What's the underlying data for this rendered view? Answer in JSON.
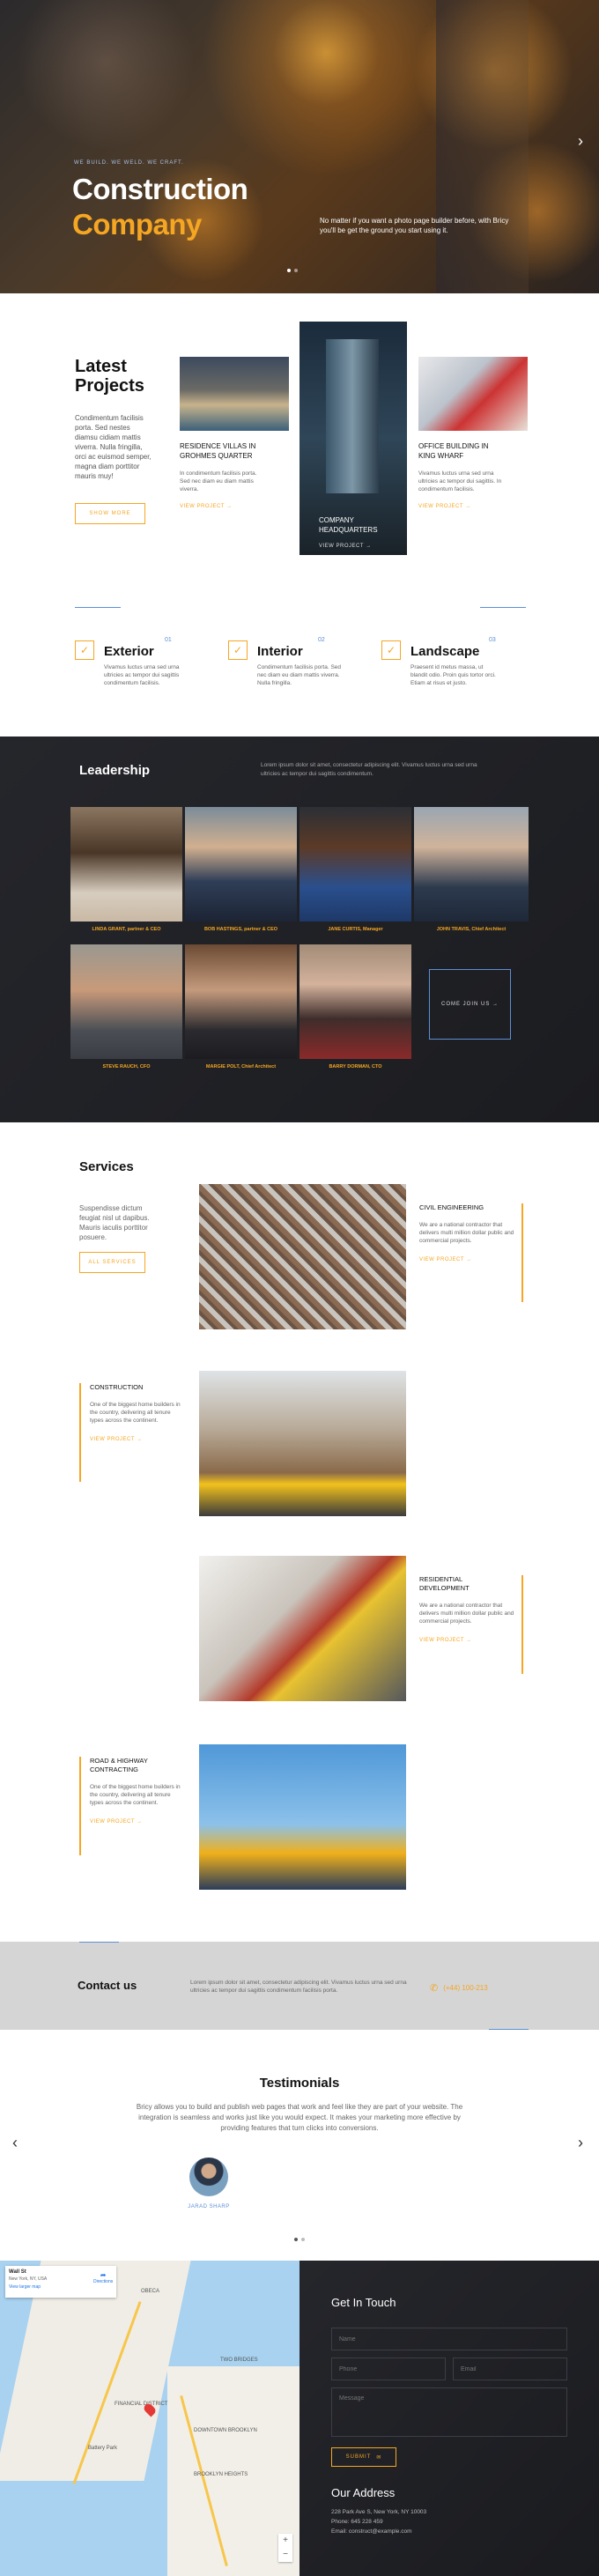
{
  "hero": {
    "eyebrow": "WE BUILD. WE WELD. WE CRAFT.",
    "title_line1": "Construction",
    "title_line2": "Company",
    "tagline": "No matter if you want a photo page builder before, with Bricy you'll be get the ground you start using it.",
    "arrow_left": "‹",
    "arrow_right": "›"
  },
  "projects": {
    "heading_line1": "Latest",
    "heading_line2": "Projects",
    "intro": "Condimentum facilisis porta. Sed nestes diamsu cidiam mattis viverra. Nulla fringilla, orci ac euismod semper, magna diam porttitor mauris muy!",
    "show_more": "SHOW MORE",
    "items": [
      {
        "title": "RESIDENCE VILLAS IN GROHMES QUARTER",
        "text": "In condimentum facilisis porta. Sed nec diam eu diam mattis viverra.",
        "link": "VIEW PROJECT"
      },
      {
        "title": "COMPANY HEADQUARTERS",
        "text": "",
        "link": "VIEW PROJECT"
      },
      {
        "title": "OFFICE BUILDING IN KING WHARF",
        "text": "Vivamus luctus urna sed urna ultricies ac tempor dui sagittis. In condimentum facilisis.",
        "link": "VIEW PROJECT"
      }
    ]
  },
  "features": [
    {
      "num": "01",
      "title": "Exterior",
      "text": "Vivamus luctus urna sed urna ultricies ac tempor dui sagittis condimentum facilisis."
    },
    {
      "num": "02",
      "title": "Interior",
      "text": "Condimentum facilisis porta. Sed nec diam eu diam mattis viverra. Nulla fringilla."
    },
    {
      "num": "03",
      "title": "Landscape",
      "text": "Praesent id metus massa, ut blandit odio. Proin quis tortor orci. Etiam at risus et justo."
    }
  ],
  "leadership": {
    "heading": "Leadership",
    "intro": "Lorem ipsum dolor sit amet, consectetur adipiscing elit. Vivamus luctus urna sed urna ultricies ac tempor dui sagittis condimentum.",
    "people": [
      {
        "name": "LINDA GRANT, partner & CEO"
      },
      {
        "name": "BOB HASTINGS, partner & CEO"
      },
      {
        "name": "JANE CURTIS, Manager"
      },
      {
        "name": "JOHN TRAVIS, Chief Architect"
      },
      {
        "name": "STEVE RAUCH, CFO"
      },
      {
        "name": "MARGIE POLT, Chief Architect"
      },
      {
        "name": "BARRY DORMAN, CTO"
      }
    ],
    "join": "COME JOIN US"
  },
  "services": {
    "heading": "Services",
    "intro": "Suspendisse dictum feugiat nisl ut dapibus. Mauris iaculis porttitor posuere.",
    "all_button": "ALL SERVICES",
    "items": [
      {
        "title": "CIVIL ENGINEERING",
        "text": "We are a national contractor that delivers multi million dollar public and commercial projects.",
        "link": "VIEW PROJECT"
      },
      {
        "title": "CONSTRUCTION",
        "text": "One of the biggest home builders in the country, delivering all tenure types across the continent.",
        "link": "VIEW PROJECT"
      },
      {
        "title": "RESIDENTIAL DEVELOPMENT",
        "text": "We are a national contractor that delivers multi million dollar public and commercial projects.",
        "link": "VIEW PROJECT"
      },
      {
        "title": "ROAD & HIGHWAY CONTRACTING",
        "text": "One of the biggest home builders in the country, delivering all tenure types across the continent.",
        "link": "VIEW PROJECT"
      }
    ]
  },
  "contact": {
    "heading": "Contact us",
    "text": "Lorem ipsum dolor sit amet, consectetur adipiscing elit. Vivamus luctus urna sed urna ultricies ac tempor dui sagittis condimentum facilisis porta.",
    "phone": "(+44) 100-213"
  },
  "testimonials": {
    "heading": "Testimonials",
    "quote": "Bricy allows you to build and publish web pages that work and feel like they are part of your website. The integration is seamless and works just like you would expect. It makes your marketing more effective by providing features that turn clicks into conversions.",
    "author": "JARAD SHARP",
    "prev": "‹",
    "next": "›"
  },
  "map": {
    "place": "Wall St",
    "address": "New York, NY, USA",
    "larger": "View larger map",
    "directions": "Directions",
    "labels": [
      "OBECA",
      "TWO BRIDGES",
      "FINANCIAL DISTRICT",
      "DOWNTOWN BROOKLYN",
      "BROOKLYN HEIGHTS",
      "Battery Park"
    ]
  },
  "form": {
    "heading": "Get In Touch",
    "name_ph": "Name",
    "phone_ph": "Phone",
    "email_ph": "Email",
    "message_ph": "Message",
    "submit": "SUBMIT"
  },
  "address": {
    "heading": "Our Address",
    "line1": "228 Park Ave S, New York, NY 10003",
    "line2": "Phone: 645 228 459",
    "line3": "Email: construct@example.com"
  },
  "colors": {
    "accent": "#f5a623",
    "dark": "#1e1f24",
    "blue": "#5b8fd6"
  }
}
